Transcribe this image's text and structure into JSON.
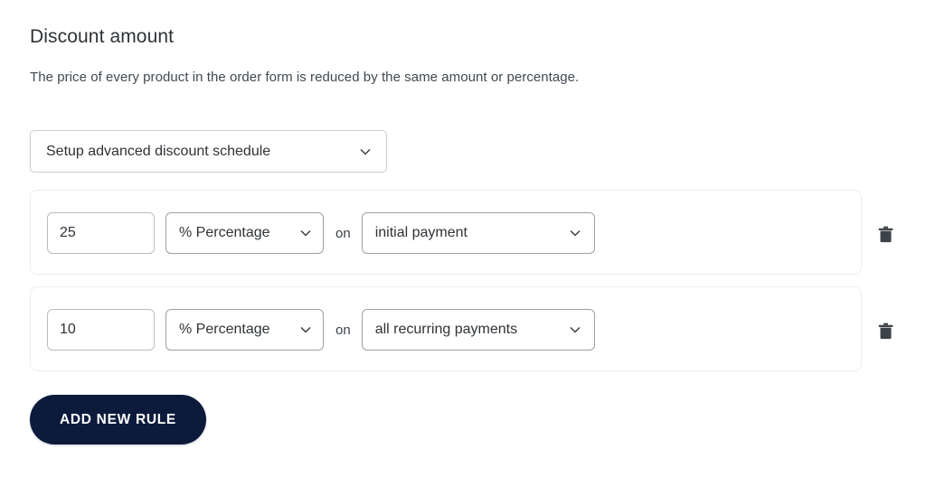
{
  "section": {
    "title": "Discount amount",
    "description": "The price of every product in the order form is reduced by the same amount or percentage."
  },
  "schedule_select": {
    "value": "Setup advanced discount schedule",
    "icon": "chevron-down-icon"
  },
  "rules": [
    {
      "amount": "25",
      "amount_placeholder": "0",
      "type": "% Percentage",
      "conjunction": "on",
      "target": "initial payment",
      "delete_icon": "trash-icon"
    },
    {
      "amount": "10",
      "amount_placeholder": "0",
      "type": "% Percentage",
      "conjunction": "on",
      "target": "all recurring payments",
      "delete_icon": "trash-icon"
    }
  ],
  "add_rule_button": {
    "label": "ADD NEW RULE"
  },
  "colors": {
    "button_background": "#0c1a3c",
    "button_text": "#ffffff",
    "heading_text": "#2f3337",
    "body_text": "#424952",
    "card_border": "#ececee",
    "control_border": "#9aa0a6"
  }
}
